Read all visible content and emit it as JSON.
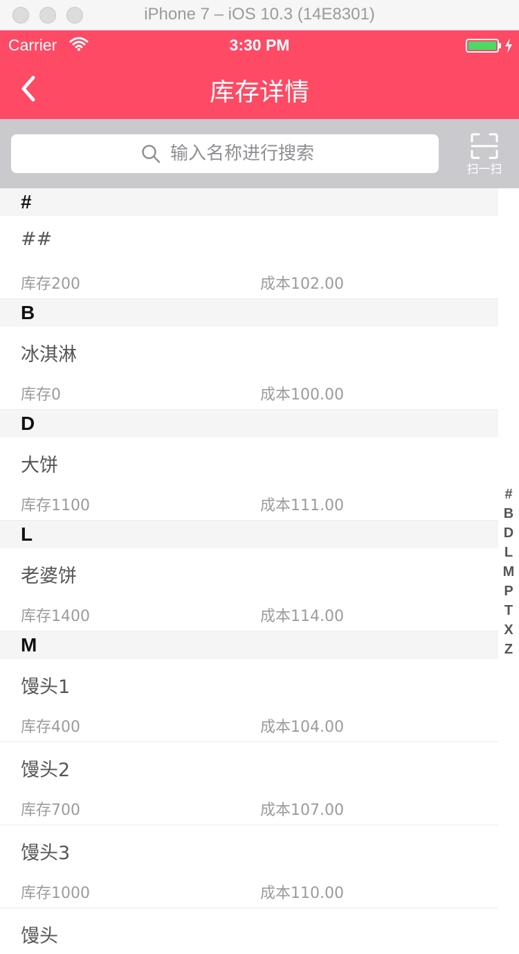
{
  "simulator": {
    "title": "iPhone 7 – iOS 10.3 (14E8301)"
  },
  "status_bar": {
    "carrier": "Carrier",
    "time": "3:30 PM"
  },
  "nav": {
    "title": "库存详情"
  },
  "search": {
    "placeholder": "输入名称进行搜索",
    "scan_label": "扫一扫"
  },
  "colors": {
    "accent": "#fe4a64",
    "search_bg": "#c9c9ce",
    "section_bg": "#f5f5f5",
    "battery": "#4cd964"
  },
  "sections": [
    {
      "letter": "#",
      "items": [
        {
          "name": "##",
          "stock": "库存200",
          "cost": "成本102.00"
        }
      ]
    },
    {
      "letter": "B",
      "items": [
        {
          "name": "冰淇淋",
          "stock": "库存0",
          "cost": "成本100.00"
        }
      ]
    },
    {
      "letter": "D",
      "items": [
        {
          "name": "大饼",
          "stock": "库存1100",
          "cost": "成本111.00"
        }
      ]
    },
    {
      "letter": "L",
      "items": [
        {
          "name": "老婆饼",
          "stock": "库存1400",
          "cost": "成本114.00"
        }
      ]
    },
    {
      "letter": "M",
      "items": [
        {
          "name": "馒头1",
          "stock": "库存400",
          "cost": "成本104.00"
        },
        {
          "name": "馒头2",
          "stock": "库存700",
          "cost": "成本107.00"
        },
        {
          "name": "馒头3",
          "stock": "库存1000",
          "cost": "成本110.00"
        },
        {
          "name": "馒头",
          "stock": "",
          "cost": ""
        }
      ]
    }
  ],
  "index": [
    "#",
    "B",
    "D",
    "L",
    "M",
    "P",
    "T",
    "X",
    "Z"
  ]
}
